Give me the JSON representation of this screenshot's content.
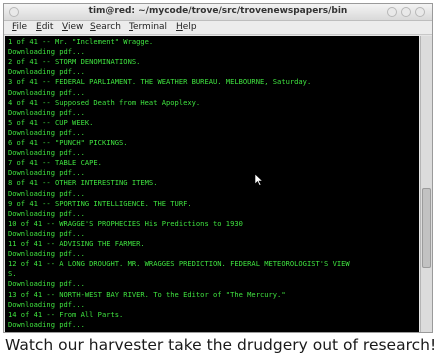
{
  "window": {
    "title": "tim@red: ~/mycode/trove/src/trovenewspapers/bin"
  },
  "menu": [
    {
      "mnemonic": "F",
      "rest": "ile"
    },
    {
      "mnemonic": "E",
      "rest": "dit"
    },
    {
      "mnemonic": "V",
      "rest": "iew"
    },
    {
      "mnemonic": "S",
      "rest": "earch"
    },
    {
      "mnemonic": "T",
      "rest": "erminal"
    },
    {
      "mnemonic": "H",
      "rest": "elp"
    }
  ],
  "terminal": {
    "lines": [
      "1 of 41 -- Mr. \"Inclement\" Wragge.",
      "Downloading pdf...",
      "2 of 41 -- STORM DENOMINATIONS.",
      "Downloading pdf...",
      "3 of 41 -- FEDERAL PARLIAMENT. THE WEATHER BUREAU. MELBOURNE, Saturday.",
      "Downloading pdf...",
      "4 of 41 -- Supposed Death from Heat Apoplexy.",
      "Downloading pdf...",
      "5 of 41 -- CUP WEEK.",
      "Downloading pdf...",
      "6 of 41 -- \"PUNCH\" PICKINGS.",
      "Downloading pdf...",
      "7 of 41 -- TABLE CAPE.",
      "Downloading pdf...",
      "8 of 41 -- OTHER INTERESTING ITEMS.",
      "Downloading pdf...",
      "9 of 41 -- SPORTING INTELLIGENCE. THE TURF.",
      "Downloading pdf...",
      "10 of 41 -- WRAGGE'S PROPHECIES His Predictions to 1930",
      "Downloading pdf...",
      "11 of 41 -- ADVISING THE FARMER.",
      "Downloading pdf...",
      "12 of 41 -- A LONG DROUGHT. MR. WRAGGES PREDICTION. FEDERAL METEOROLOGIST'S VIEW",
      "S.",
      "Downloading pdf...",
      "13 of 41 -- NORTH-WEST BAY RIVER. To the Editor of \"The Mercury.\"",
      "Downloading pdf...",
      "14 of 41 -- From All Parts.",
      "Downloading pdf..."
    ]
  },
  "caption": "Watch our harvester take the drudgery out of research!"
}
